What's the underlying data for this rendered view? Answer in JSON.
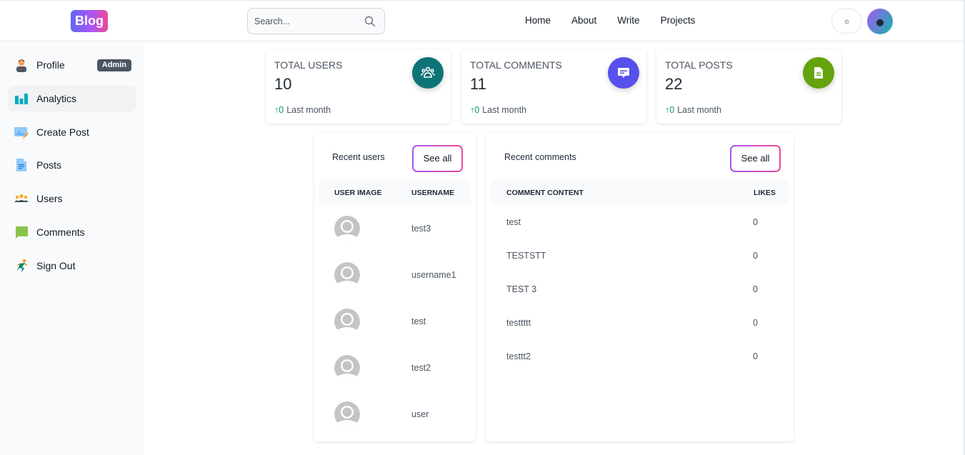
{
  "header": {
    "logo": "Blog",
    "search": {
      "placeholder": "Search...",
      "value": ""
    },
    "nav": [
      "Home",
      "About",
      "Write",
      "Projects"
    ],
    "theme_toggle_icon": "sun-icon",
    "avatar_icon": "user-avatar"
  },
  "sidebar": {
    "items": [
      {
        "label": "Profile",
        "icon": "profile-icon",
        "badge": "Admin",
        "active": false
      },
      {
        "label": "Analytics",
        "icon": "analytics-icon",
        "active": true
      },
      {
        "label": "Create Post",
        "icon": "create-post-icon",
        "active": false
      },
      {
        "label": "Posts",
        "icon": "posts-icon",
        "active": false
      },
      {
        "label": "Users",
        "icon": "users-icon",
        "active": false
      },
      {
        "label": "Comments",
        "icon": "comments-icon",
        "active": false
      },
      {
        "label": "Sign Out",
        "icon": "sign-out-icon",
        "active": false
      }
    ]
  },
  "stats": [
    {
      "title": "TOTAL USERS",
      "value": "10",
      "trend": "0",
      "trend_label": "Last month",
      "icon": "users-group-icon",
      "color": "#0e7377"
    },
    {
      "title": "TOTAL COMMENTS",
      "value": "11",
      "trend": "0",
      "trend_label": "Last month",
      "icon": "comment-icon",
      "color": "#5850ec"
    },
    {
      "title": "TOTAL POSTS",
      "value": "22",
      "trend": "0",
      "trend_label": "Last month",
      "icon": "document-icon",
      "color": "#65a30d"
    }
  ],
  "recent_users": {
    "title": "Recent users",
    "see_all": "See all",
    "columns": [
      "USER IMAGE",
      "USERNAME"
    ],
    "rows": [
      {
        "username": "test3"
      },
      {
        "username": "username1"
      },
      {
        "username": "test"
      },
      {
        "username": "test2"
      },
      {
        "username": "user"
      }
    ]
  },
  "recent_comments": {
    "title": "Recent comments",
    "see_all": "See all",
    "columns": [
      "COMMENT CONTENT",
      "LIKES"
    ],
    "rows": [
      {
        "content": "test",
        "likes": "0"
      },
      {
        "content": "TESTSTT",
        "likes": "0"
      },
      {
        "content": "TEST 3",
        "likes": "0"
      },
      {
        "content": "testtttt",
        "likes": "0"
      },
      {
        "content": "testtt2",
        "likes": "0"
      }
    ]
  }
}
